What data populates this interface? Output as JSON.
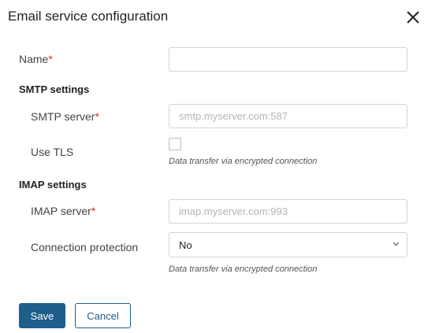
{
  "dialog": {
    "title": "Email service configuration",
    "close_icon": "close-icon"
  },
  "fields": {
    "name": {
      "label": "Name",
      "required_mark": "*",
      "value": ""
    }
  },
  "smtp": {
    "heading": "SMTP settings",
    "server": {
      "label": "SMTP server",
      "required_mark": "*",
      "placeholder": "smtp.myserver.com:587",
      "value": ""
    },
    "tls": {
      "label": "Use TLS",
      "checked": false,
      "hint": "Data transfer via encrypted connection"
    }
  },
  "imap": {
    "heading": "IMAP settings",
    "server": {
      "label": "IMAP server",
      "required_mark": "*",
      "placeholder": "imap.myserver.com:993",
      "value": ""
    },
    "protection": {
      "label": "Connection protection",
      "selected": "No",
      "hint": "Data transfer via encrypted connection"
    }
  },
  "actions": {
    "save_label": "Save",
    "cancel_label": "Cancel"
  },
  "colors": {
    "primary": "#1f5d8c",
    "required": "#d32f2f",
    "border": "#d4d4d4"
  }
}
